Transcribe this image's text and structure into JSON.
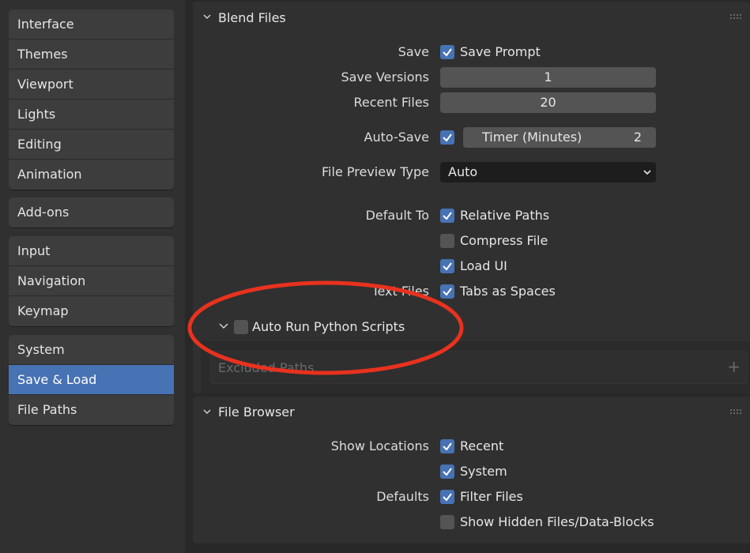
{
  "sidebar": {
    "group1": [
      {
        "label": "Interface"
      },
      {
        "label": "Themes"
      },
      {
        "label": "Viewport"
      },
      {
        "label": "Lights"
      },
      {
        "label": "Editing"
      },
      {
        "label": "Animation"
      }
    ],
    "group2": [
      {
        "label": "Add-ons"
      }
    ],
    "group3": [
      {
        "label": "Input"
      },
      {
        "label": "Navigation"
      },
      {
        "label": "Keymap"
      }
    ],
    "group4": [
      {
        "label": "System"
      },
      {
        "label": "Save & Load"
      },
      {
        "label": "File Paths"
      }
    ],
    "active": "Save & Load"
  },
  "blend_files": {
    "title": "Blend Files",
    "save_label": "Save",
    "save_prompt": {
      "label": "Save Prompt",
      "checked": true
    },
    "save_versions": {
      "label": "Save Versions",
      "value": "1"
    },
    "recent_files": {
      "label": "Recent Files",
      "value": "20"
    },
    "auto_save": {
      "label": "Auto-Save",
      "checked": true,
      "timer_label": "Timer (Minutes)",
      "timer_value": "2"
    },
    "file_preview_type": {
      "label": "File Preview Type",
      "value": "Auto"
    },
    "default_to_label": "Default To",
    "relative_paths": {
      "label": "Relative Paths",
      "checked": true
    },
    "compress_file": {
      "label": "Compress File",
      "checked": false
    },
    "load_ui": {
      "label": "Load UI",
      "checked": true
    },
    "text_files_label": "Text Files",
    "tabs_as_spaces": {
      "label": "Tabs as Spaces",
      "checked": true
    },
    "auto_run": {
      "label": "Auto Run Python Scripts",
      "checked": false
    },
    "excluded_paths_label": "Excluded Paths"
  },
  "file_browser": {
    "title": "File Browser",
    "show_locations_label": "Show Locations",
    "recent": {
      "label": "Recent",
      "checked": true
    },
    "system": {
      "label": "System",
      "checked": true
    },
    "defaults_label": "Defaults",
    "filter_files": {
      "label": "Filter Files",
      "checked": true
    },
    "show_hidden": {
      "label": "Show Hidden Files/Data-Blocks",
      "checked": false
    }
  },
  "colors": {
    "accent": "#4772b3",
    "annotation": "#e8321e"
  }
}
